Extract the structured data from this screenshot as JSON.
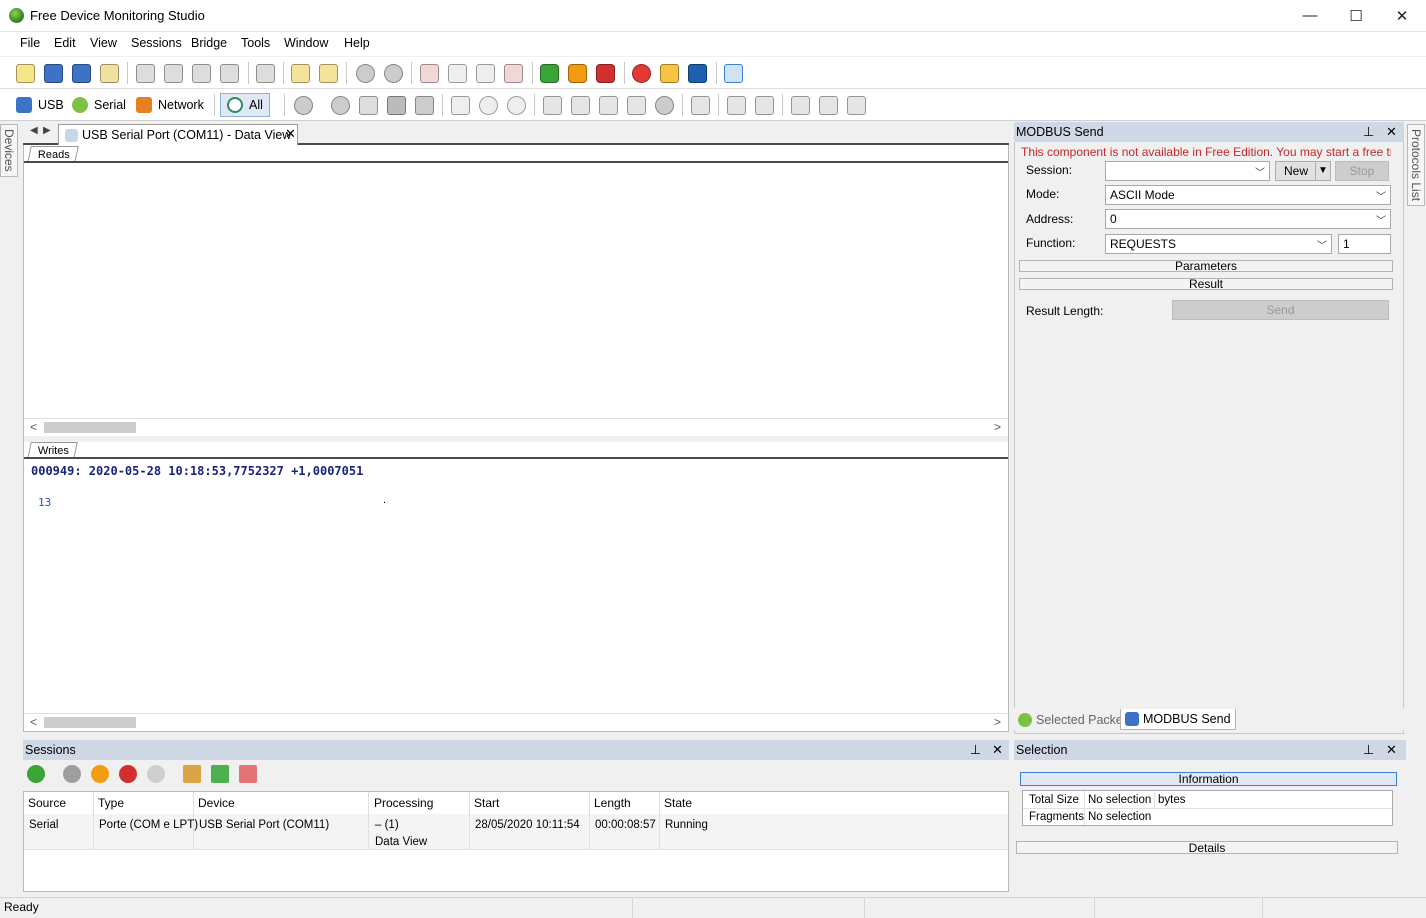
{
  "window": {
    "title": "Free Device Monitoring Studio",
    "minimize": "—",
    "maximize": "☐",
    "close": "✕"
  },
  "menu": [
    "File",
    "Edit",
    "View",
    "Sessions",
    "Bridge",
    "Tools",
    "Window",
    "Help"
  ],
  "toolbar2": {
    "usb": "USB",
    "serial": "Serial",
    "network": "Network",
    "all": "All"
  },
  "strips": {
    "left": "Devices",
    "right": "Protocols List"
  },
  "document": {
    "tab_title": "USB Serial Port (COM11) - Data View",
    "reads_tab": "Reads",
    "writes_tab": "Writes",
    "writes_header": "000949: 2020-05-28 10:18:53,7752327 +1,0007051",
    "writes_byte": "13",
    "writes_char": "."
  },
  "modbus": {
    "title": "MODBUS Send",
    "warning": "This component is not available in Free Edition. You may start a free trial t...",
    "session_label": "Session:",
    "session_value": "",
    "new_btn": "New",
    "stop_btn": "Stop",
    "mode_label": "Mode:",
    "mode_value": "ASCII Mode",
    "address_label": "Address:",
    "address_value": "0",
    "function_label": "Function:",
    "function_value": "REQUESTS",
    "function_count": "1",
    "parameters": "Parameters",
    "result": "Result",
    "result_length_label": "Result Length:",
    "send_btn": "Send"
  },
  "bottom_tabs": {
    "selected_packet": "Selected Packet",
    "modbus_send": "MODBUS Send"
  },
  "sessions": {
    "title": "Sessions",
    "columns": [
      "Source",
      "Type",
      "Device",
      "Processing",
      "Start",
      "Length",
      "State"
    ],
    "rows": [
      {
        "source": "Serial",
        "type": "Porte (COM e LPT)",
        "device": "USB Serial Port (COM11)",
        "processing": "– (1)",
        "processing2": "Data View",
        "start": "28/05/2020 10:11:54",
        "length": "00:00:08:57",
        "state": "Running"
      }
    ]
  },
  "selection": {
    "title": "Selection",
    "information": "Information",
    "total_size_label": "Total Size",
    "total_size_value": "No selection",
    "total_size_unit": "bytes",
    "fragments_label": "Fragments",
    "fragments_value": "No selection",
    "details": "Details"
  },
  "status": {
    "text": "Ready"
  },
  "colors": {
    "accent": "#cfd9e6",
    "warning": "#c62828",
    "hex_header": "#1a237e"
  }
}
